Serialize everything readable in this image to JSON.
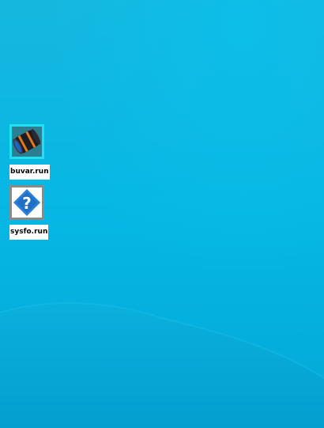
{
  "desktop": {
    "background_color": "#04b6e3",
    "icons": [
      {
        "label": "buvar.run",
        "icon": "barrel-package-icon",
        "tile_color": "#22dff2"
      },
      {
        "label": "sysfo.run",
        "icon": "help-diamond-icon",
        "tile_color": "#8a8a8a",
        "accent_color": "#2a7fd4"
      }
    ]
  }
}
